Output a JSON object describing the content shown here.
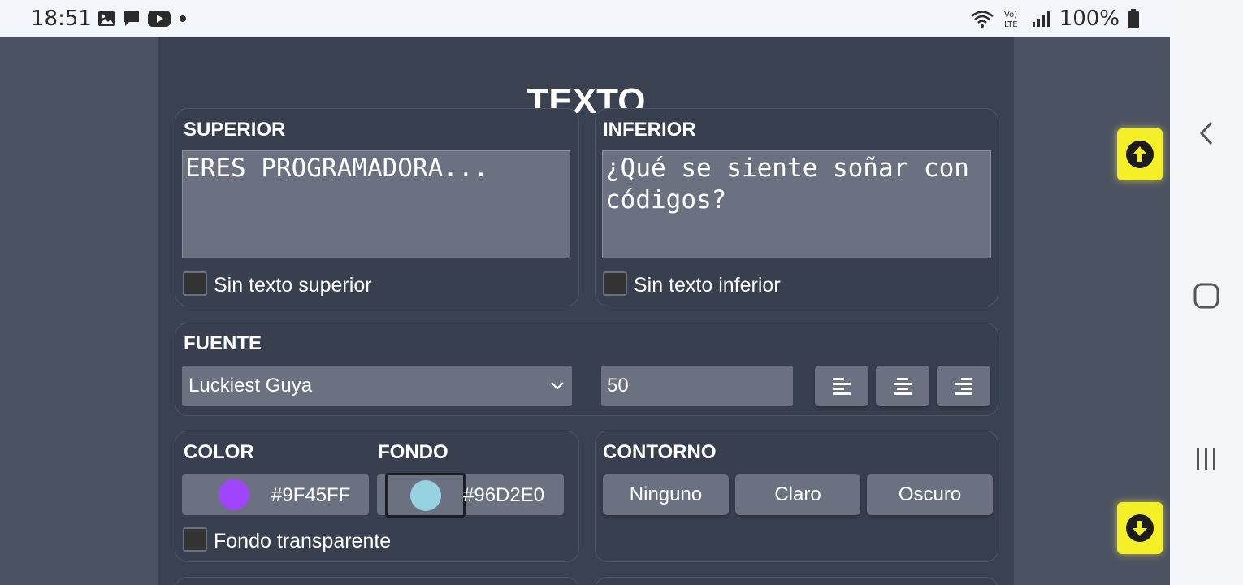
{
  "status_bar": {
    "time": "18:51",
    "battery": "100%",
    "left_icons": [
      "gallery-icon",
      "message-icon",
      "youtube-icon",
      "dot-icon"
    ],
    "right_icons": [
      "wifi-icon",
      "volte-icon",
      "signal-icon",
      "battery-icon"
    ]
  },
  "panel": {
    "title": "TEXTO"
  },
  "superior": {
    "label": "SUPERIOR",
    "value": "ERES PROGRAMADORA...",
    "checkbox_label": "Sin texto superior",
    "checked": false
  },
  "inferior": {
    "label": "INFERIOR",
    "value": "¿Qué se siente soñar con códigos?",
    "checkbox_label": "Sin texto inferior",
    "checked": false
  },
  "fuente": {
    "label": "FUENTE",
    "font_selected": "Luckiest Guya",
    "size": "50",
    "align_buttons": [
      "align-left-icon",
      "align-center-icon",
      "align-right-icon"
    ]
  },
  "color": {
    "label": "COLOR",
    "hex": "#9F45FF",
    "swatch": "#9F45FF"
  },
  "fondo": {
    "label": "FONDO",
    "hex": "#96D2E0",
    "swatch": "#96D2E0",
    "transparent_label": "Fondo transparente",
    "transparent_checked": false
  },
  "contorno": {
    "label": "CONTORNO",
    "options": [
      "Ninguno",
      "Claro",
      "Oscuro"
    ]
  },
  "colors": {
    "panel_bg": "#3a4151",
    "page_bg": "#4b5363",
    "input_bg": "#6b7180",
    "float_button": "#f5ef28"
  }
}
